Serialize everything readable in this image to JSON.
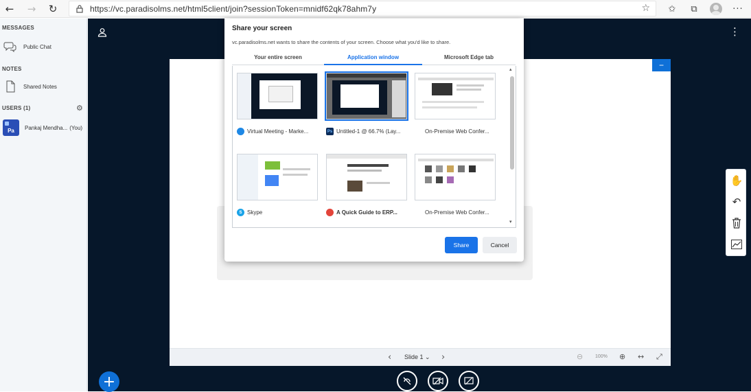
{
  "browser": {
    "url": "https://vc.paradisolms.net/html5client/join?sessionToken=mnidf62qk78ahm7y",
    "icons": [
      "back-icon",
      "forward-icon",
      "refresh-icon",
      "lock-icon",
      "favorite-star-icon",
      "favorites-icon",
      "collections-icon",
      "profile-avatar",
      "more-icon"
    ]
  },
  "sidebar": {
    "messages_title": "MESSAGES",
    "public_chat": "Public Chat",
    "notes_title": "NOTES",
    "shared_notes": "Shared Notes",
    "users_title": "USERS (1)",
    "user_initials": "Pa",
    "user_name": "Pankaj Mendha...",
    "user_you": "(You)"
  },
  "presentation": {
    "slide_label": "Slide 1",
    "zoom": "100%",
    "minimize_label": "−"
  },
  "dialog": {
    "title": "Share your screen",
    "description": "vc.paradisolms.net wants to share the contents of your screen. Choose what you'd like to share.",
    "tabs": [
      "Your entire screen",
      "Application window",
      "Microsoft Edge tab"
    ],
    "active_tab": "Application window",
    "windows": [
      {
        "label": "Virtual Meeting - Marke...",
        "app_icon": "edge-icon",
        "color": "#1e88e5"
      },
      {
        "label": "Untitled-1 @ 66.7% (Lay...",
        "app_icon": "photoshop-icon",
        "color": "#0b2c5a",
        "selected": true
      },
      {
        "label": "On-Premise Web Confer...",
        "app_icon": "document-icon",
        "color": "#c9a45a"
      },
      {
        "label": "Skype",
        "app_icon": "skype-icon",
        "color": "#1aa3e8"
      },
      {
        "label": "A Quick Guide to ERP...",
        "app_icon": "chrome-icon",
        "color": "#e3443a"
      },
      {
        "label": "On-Premise Web Confer...",
        "app_icon": "document-icon",
        "color": "#c9a45a"
      }
    ],
    "share_label": "Share",
    "cancel_label": "Cancel"
  },
  "colors": {
    "accent": "#1a73e8",
    "main_bg": "#06172a",
    "primary_button": "#0f70d7"
  }
}
